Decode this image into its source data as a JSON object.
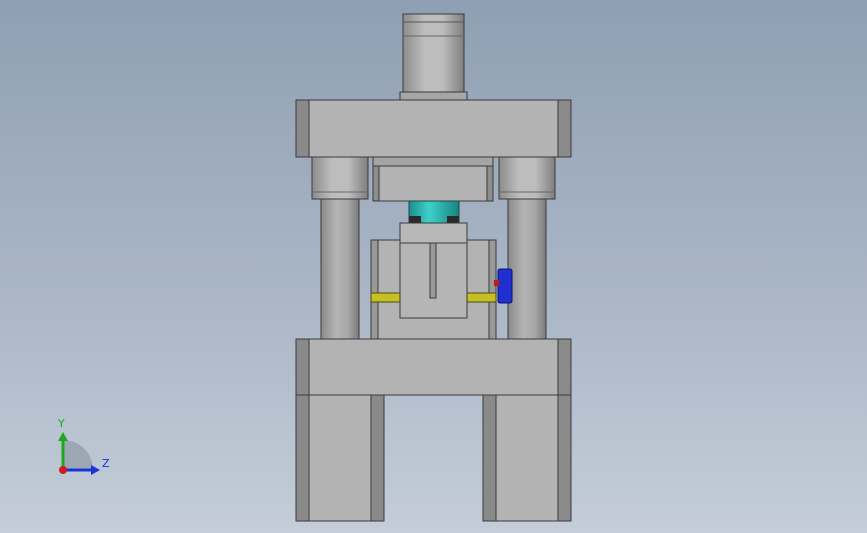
{
  "triad": {
    "y_label": "Y",
    "z_label": "Z"
  },
  "colors": {
    "background_top": "#8f9fb3",
    "background_bottom": "#c4cdd9",
    "part_gray": "#b0b0b0",
    "part_edge": "#3a3a3a",
    "part_dark": "#808080",
    "cylinder_teal": "#2fb9b4",
    "clamp_blue": "#1f2fd0",
    "strip_yellow": "#c8c020",
    "axis_y": "#1ea81e",
    "axis_z": "#1a35d6",
    "axis_x": "#d01a1a"
  }
}
